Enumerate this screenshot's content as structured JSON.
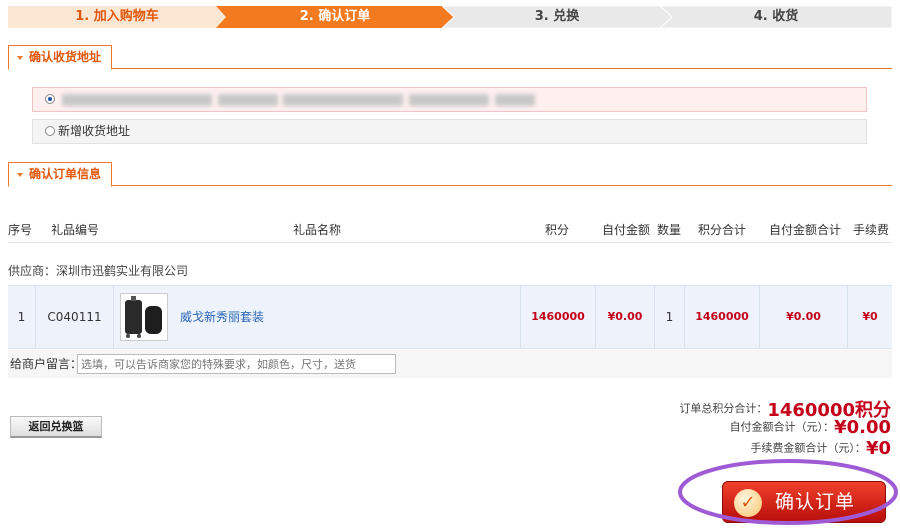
{
  "steps": [
    {
      "label": "1. 加入购物车",
      "state": "done"
    },
    {
      "label": "2. 确认订单",
      "state": "active"
    },
    {
      "label": "3. 兑换",
      "state": "todo"
    },
    {
      "label": "4. 收货",
      "state": "todo"
    }
  ],
  "colors": {
    "accent": "#f47a20",
    "price_red": "#c4001a",
    "link": "#2a64b4",
    "annotation": "#9f5bd6"
  },
  "address_section": {
    "title": "确认收货地址",
    "new_address_label": "新增收货地址"
  },
  "order_section": {
    "title": "确认订单信息",
    "columns": [
      "序号",
      "礼品编号",
      "礼品名称",
      "积分",
      "自付金额",
      "数量",
      "积分合计",
      "自付金额合计",
      "手续费"
    ],
    "supplier_label": "供应商：深圳市迅鹤实业有限公司",
    "rows": [
      {
        "no": "1",
        "code": "C040111",
        "name": "威戈新秀丽套装",
        "points": "1460000",
        "self_pay": "¥0.00",
        "qty": "1",
        "points_total": "1460000",
        "self_pay_total": "¥0.00",
        "fee": "¥0"
      }
    ],
    "message_label": "给商户留言：",
    "message_placeholder": "选填，可以告诉商家您的特殊要求，如颜色，尺寸，送货"
  },
  "footer": {
    "back_button": "返回兑换篮",
    "total_points_label": "订单总积分合计：",
    "total_points_value": "1460000积分",
    "self_pay_label": "自付金额合计（元）：",
    "self_pay_value": "¥0.00",
    "fee_label": "手续费金额合计（元）：",
    "fee_value": "¥0",
    "confirm_button": "确认订单",
    "confirm_icon": "check-icon"
  }
}
